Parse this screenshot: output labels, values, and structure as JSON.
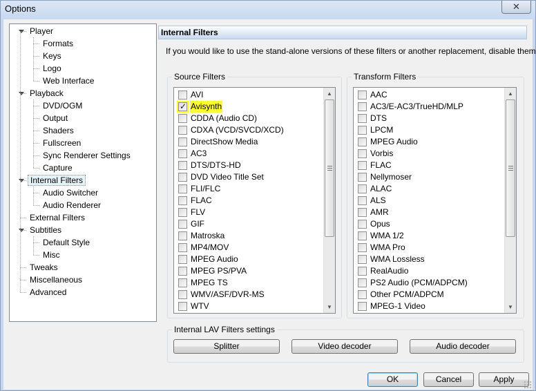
{
  "window": {
    "title": "Options",
    "close_glyph": "✕"
  },
  "tree": {
    "items": [
      {
        "label": "Player",
        "level": 0,
        "expanded": true
      },
      {
        "label": "Formats",
        "level": 1
      },
      {
        "label": "Keys",
        "level": 1
      },
      {
        "label": "Logo",
        "level": 1
      },
      {
        "label": "Web Interface",
        "level": 1
      },
      {
        "label": "Playback",
        "level": 0,
        "expanded": true
      },
      {
        "label": "DVD/OGM",
        "level": 1
      },
      {
        "label": "Output",
        "level": 1
      },
      {
        "label": "Shaders",
        "level": 1
      },
      {
        "label": "Fullscreen",
        "level": 1
      },
      {
        "label": "Sync Renderer Settings",
        "level": 1
      },
      {
        "label": "Capture",
        "level": 1
      },
      {
        "label": "Internal Filters",
        "level": 0,
        "expanded": true,
        "selected": true
      },
      {
        "label": "Audio Switcher",
        "level": 1
      },
      {
        "label": "Audio Renderer",
        "level": 1
      },
      {
        "label": "External Filters",
        "level": 0
      },
      {
        "label": "Subtitles",
        "level": 0,
        "expanded": true
      },
      {
        "label": "Default Style",
        "level": 1
      },
      {
        "label": "Misc",
        "level": 1
      },
      {
        "label": "Tweaks",
        "level": 0
      },
      {
        "label": "Miscellaneous",
        "level": 0
      },
      {
        "label": "Advanced",
        "level": 0
      }
    ]
  },
  "page": {
    "title": "Internal Filters",
    "description": "If you would like to use the stand-alone versions of these filters or another replacement, disable them here."
  },
  "source_filters": {
    "title": "Source Filters",
    "scroll_fraction": 0.0,
    "items": [
      {
        "label": "AVI",
        "checked": false
      },
      {
        "label": "Avisynth",
        "checked": true,
        "highlighted": true
      },
      {
        "label": "CDDA (Audio CD)",
        "checked": false
      },
      {
        "label": "CDXA (VCD/SVCD/XCD)",
        "checked": false
      },
      {
        "label": "DirectShow Media",
        "checked": false
      },
      {
        "label": "AC3",
        "checked": false
      },
      {
        "label": "DTS/DTS-HD",
        "checked": false
      },
      {
        "label": "DVD Video Title Set",
        "checked": false
      },
      {
        "label": "FLI/FLC",
        "checked": false
      },
      {
        "label": "FLAC",
        "checked": false
      },
      {
        "label": "FLV",
        "checked": false
      },
      {
        "label": "GIF",
        "checked": false
      },
      {
        "label": "Matroska",
        "checked": false
      },
      {
        "label": "MP4/MOV",
        "checked": false
      },
      {
        "label": "MPEG Audio",
        "checked": false
      },
      {
        "label": "MPEG PS/PVA",
        "checked": false
      },
      {
        "label": "MPEG TS",
        "checked": false
      },
      {
        "label": "WMV/ASF/DVR-MS",
        "checked": false
      },
      {
        "label": "WTV",
        "checked": false
      }
    ]
  },
  "transform_filters": {
    "title": "Transform Filters",
    "scroll_fraction": 0.0,
    "items": [
      {
        "label": "AAC",
        "checked": false
      },
      {
        "label": "AC3/E-AC3/TrueHD/MLP",
        "checked": false
      },
      {
        "label": "DTS",
        "checked": false
      },
      {
        "label": "LPCM",
        "checked": false
      },
      {
        "label": "MPEG Audio",
        "checked": false
      },
      {
        "label": "Vorbis",
        "checked": false
      },
      {
        "label": "FLAC",
        "checked": false
      },
      {
        "label": "Nellymoser",
        "checked": false
      },
      {
        "label": "ALAC",
        "checked": false
      },
      {
        "label": "ALS",
        "checked": false
      },
      {
        "label": "AMR",
        "checked": false
      },
      {
        "label": "Opus",
        "checked": false
      },
      {
        "label": "WMA 1/2",
        "checked": false
      },
      {
        "label": "WMA Pro",
        "checked": false
      },
      {
        "label": "WMA Lossless",
        "checked": false
      },
      {
        "label": "RealAudio",
        "checked": false
      },
      {
        "label": "PS2 Audio (PCM/ADPCM)",
        "checked": false
      },
      {
        "label": "Other PCM/ADPCM",
        "checked": false
      },
      {
        "label": "MPEG-1 Video",
        "checked": false
      }
    ]
  },
  "lav": {
    "title": "Internal LAV Filters settings",
    "splitter_label": "Splitter",
    "video_label": "Video decoder",
    "audio_label": "Audio decoder"
  },
  "footer": {
    "ok_label": "OK",
    "cancel_label": "Cancel",
    "apply_label": "Apply"
  },
  "icons": {
    "scroll_up": "▲",
    "scroll_down": "▼"
  }
}
